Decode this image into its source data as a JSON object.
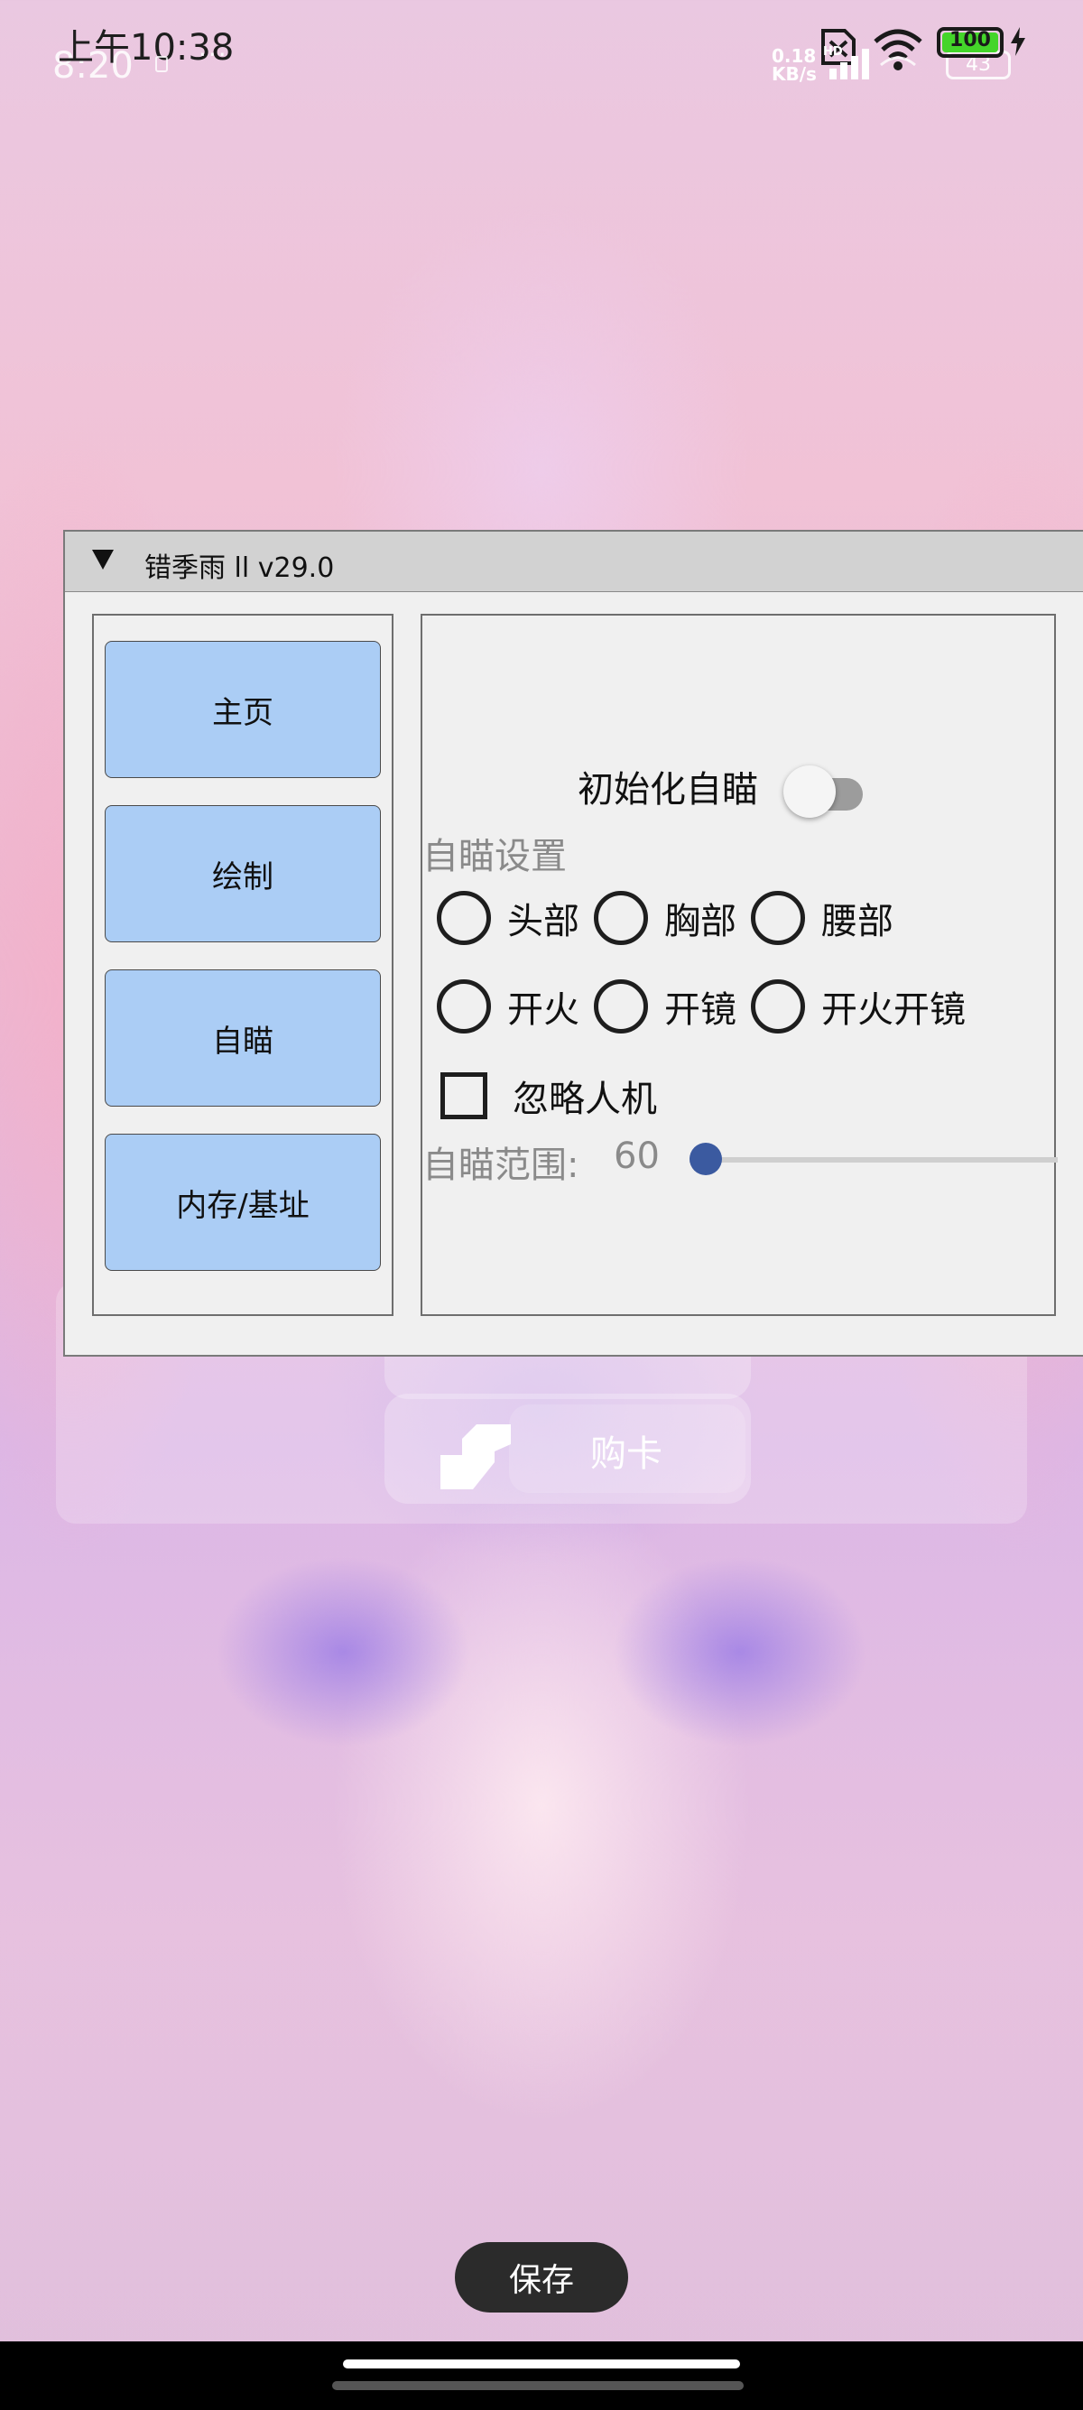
{
  "status_bar": {
    "time": "上午10:38",
    "time_secondary": "8:20",
    "ghost_dots": "···",
    "net_speed_value": "0.18",
    "net_speed_unit": "KB/s",
    "network_label": "HD",
    "battery_level": "100",
    "battery_secondary": "43"
  },
  "window": {
    "title": "错季雨 ll v29.0",
    "nav": {
      "home": "主页",
      "draw": "绘制",
      "aim": "自瞄",
      "memory": "内存/基址"
    },
    "aim_panel": {
      "init_label": "初始化自瞄",
      "init_enabled": false,
      "section_title": "自瞄设置",
      "target_options": [
        "头部",
        "胸部",
        "腰部"
      ],
      "fire_options": [
        "开火",
        "开镜",
        "开火开镜"
      ],
      "ignore_bots_label": "忽略人机",
      "ignore_bots_checked": false,
      "range_label": "自瞄范围:",
      "range_value": "60",
      "range_fraction": 0.0
    }
  },
  "background": {
    "card_button_label": "购卡"
  },
  "save_label": "保存",
  "colors": {
    "nav_button": "#abcdf5",
    "slider_thumb": "#3b5aa0",
    "battery_fill": "#44d52a"
  }
}
